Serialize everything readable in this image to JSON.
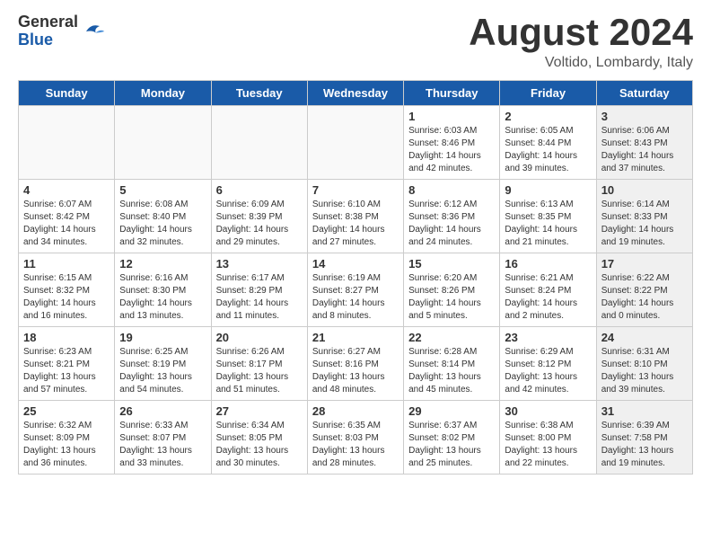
{
  "header": {
    "logo_general": "General",
    "logo_blue": "Blue",
    "month_year": "August 2024",
    "location": "Voltido, Lombardy, Italy"
  },
  "weekdays": [
    "Sunday",
    "Monday",
    "Tuesday",
    "Wednesday",
    "Thursday",
    "Friday",
    "Saturday"
  ],
  "weeks": [
    [
      {
        "day": "",
        "empty": true
      },
      {
        "day": "",
        "empty": true
      },
      {
        "day": "",
        "empty": true
      },
      {
        "day": "",
        "empty": true
      },
      {
        "day": "1",
        "line1": "Sunrise: 6:03 AM",
        "line2": "Sunset: 8:46 PM",
        "line3": "Daylight: 14 hours",
        "line4": "and 42 minutes."
      },
      {
        "day": "2",
        "line1": "Sunrise: 6:05 AM",
        "line2": "Sunset: 8:44 PM",
        "line3": "Daylight: 14 hours",
        "line4": "and 39 minutes."
      },
      {
        "day": "3",
        "shaded": true,
        "line1": "Sunrise: 6:06 AM",
        "line2": "Sunset: 8:43 PM",
        "line3": "Daylight: 14 hours",
        "line4": "and 37 minutes."
      }
    ],
    [
      {
        "day": "4",
        "line1": "Sunrise: 6:07 AM",
        "line2": "Sunset: 8:42 PM",
        "line3": "Daylight: 14 hours",
        "line4": "and 34 minutes."
      },
      {
        "day": "5",
        "line1": "Sunrise: 6:08 AM",
        "line2": "Sunset: 8:40 PM",
        "line3": "Daylight: 14 hours",
        "line4": "and 32 minutes."
      },
      {
        "day": "6",
        "line1": "Sunrise: 6:09 AM",
        "line2": "Sunset: 8:39 PM",
        "line3": "Daylight: 14 hours",
        "line4": "and 29 minutes."
      },
      {
        "day": "7",
        "line1": "Sunrise: 6:10 AM",
        "line2": "Sunset: 8:38 PM",
        "line3": "Daylight: 14 hours",
        "line4": "and 27 minutes."
      },
      {
        "day": "8",
        "line1": "Sunrise: 6:12 AM",
        "line2": "Sunset: 8:36 PM",
        "line3": "Daylight: 14 hours",
        "line4": "and 24 minutes."
      },
      {
        "day": "9",
        "line1": "Sunrise: 6:13 AM",
        "line2": "Sunset: 8:35 PM",
        "line3": "Daylight: 14 hours",
        "line4": "and 21 minutes."
      },
      {
        "day": "10",
        "shaded": true,
        "line1": "Sunrise: 6:14 AM",
        "line2": "Sunset: 8:33 PM",
        "line3": "Daylight: 14 hours",
        "line4": "and 19 minutes."
      }
    ],
    [
      {
        "day": "11",
        "line1": "Sunrise: 6:15 AM",
        "line2": "Sunset: 8:32 PM",
        "line3": "Daylight: 14 hours",
        "line4": "and 16 minutes."
      },
      {
        "day": "12",
        "line1": "Sunrise: 6:16 AM",
        "line2": "Sunset: 8:30 PM",
        "line3": "Daylight: 14 hours",
        "line4": "and 13 minutes."
      },
      {
        "day": "13",
        "line1": "Sunrise: 6:17 AM",
        "line2": "Sunset: 8:29 PM",
        "line3": "Daylight: 14 hours",
        "line4": "and 11 minutes."
      },
      {
        "day": "14",
        "line1": "Sunrise: 6:19 AM",
        "line2": "Sunset: 8:27 PM",
        "line3": "Daylight: 14 hours",
        "line4": "and 8 minutes."
      },
      {
        "day": "15",
        "line1": "Sunrise: 6:20 AM",
        "line2": "Sunset: 8:26 PM",
        "line3": "Daylight: 14 hours",
        "line4": "and 5 minutes."
      },
      {
        "day": "16",
        "line1": "Sunrise: 6:21 AM",
        "line2": "Sunset: 8:24 PM",
        "line3": "Daylight: 14 hours",
        "line4": "and 2 minutes."
      },
      {
        "day": "17",
        "shaded": true,
        "line1": "Sunrise: 6:22 AM",
        "line2": "Sunset: 8:22 PM",
        "line3": "Daylight: 14 hours",
        "line4": "and 0 minutes."
      }
    ],
    [
      {
        "day": "18",
        "line1": "Sunrise: 6:23 AM",
        "line2": "Sunset: 8:21 PM",
        "line3": "Daylight: 13 hours",
        "line4": "and 57 minutes."
      },
      {
        "day": "19",
        "line1": "Sunrise: 6:25 AM",
        "line2": "Sunset: 8:19 PM",
        "line3": "Daylight: 13 hours",
        "line4": "and 54 minutes."
      },
      {
        "day": "20",
        "line1": "Sunrise: 6:26 AM",
        "line2": "Sunset: 8:17 PM",
        "line3": "Daylight: 13 hours",
        "line4": "and 51 minutes."
      },
      {
        "day": "21",
        "line1": "Sunrise: 6:27 AM",
        "line2": "Sunset: 8:16 PM",
        "line3": "Daylight: 13 hours",
        "line4": "and 48 minutes."
      },
      {
        "day": "22",
        "line1": "Sunrise: 6:28 AM",
        "line2": "Sunset: 8:14 PM",
        "line3": "Daylight: 13 hours",
        "line4": "and 45 minutes."
      },
      {
        "day": "23",
        "line1": "Sunrise: 6:29 AM",
        "line2": "Sunset: 8:12 PM",
        "line3": "Daylight: 13 hours",
        "line4": "and 42 minutes."
      },
      {
        "day": "24",
        "shaded": true,
        "line1": "Sunrise: 6:31 AM",
        "line2": "Sunset: 8:10 PM",
        "line3": "Daylight: 13 hours",
        "line4": "and 39 minutes."
      }
    ],
    [
      {
        "day": "25",
        "line1": "Sunrise: 6:32 AM",
        "line2": "Sunset: 8:09 PM",
        "line3": "Daylight: 13 hours",
        "line4": "and 36 minutes."
      },
      {
        "day": "26",
        "line1": "Sunrise: 6:33 AM",
        "line2": "Sunset: 8:07 PM",
        "line3": "Daylight: 13 hours",
        "line4": "and 33 minutes."
      },
      {
        "day": "27",
        "line1": "Sunrise: 6:34 AM",
        "line2": "Sunset: 8:05 PM",
        "line3": "Daylight: 13 hours",
        "line4": "and 30 minutes."
      },
      {
        "day": "28",
        "line1": "Sunrise: 6:35 AM",
        "line2": "Sunset: 8:03 PM",
        "line3": "Daylight: 13 hours",
        "line4": "and 28 minutes."
      },
      {
        "day": "29",
        "line1": "Sunrise: 6:37 AM",
        "line2": "Sunset: 8:02 PM",
        "line3": "Daylight: 13 hours",
        "line4": "and 25 minutes."
      },
      {
        "day": "30",
        "line1": "Sunrise: 6:38 AM",
        "line2": "Sunset: 8:00 PM",
        "line3": "Daylight: 13 hours",
        "line4": "and 22 minutes."
      },
      {
        "day": "31",
        "shaded": true,
        "line1": "Sunrise: 6:39 AM",
        "line2": "Sunset: 7:58 PM",
        "line3": "Daylight: 13 hours",
        "line4": "and 19 minutes."
      }
    ]
  ]
}
